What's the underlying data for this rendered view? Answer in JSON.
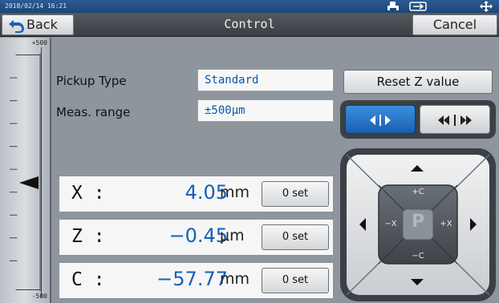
{
  "status": {
    "clock": "2018/02/14 16:21",
    "printer_icon": "printer-icon",
    "usb_icon": "usb-icon",
    "move_icon": "move-arrows-icon"
  },
  "nav": {
    "back_label": "Back",
    "title": "Control",
    "cancel_label": "Cancel"
  },
  "gauge": {
    "max_label": "+500",
    "min_label": "-500"
  },
  "info": {
    "pickup_label": "Pickup Type",
    "pickup_value": "Standard",
    "range_label": "Meas. range",
    "range_value": "±500μm"
  },
  "reset_label": "Reset Z value",
  "step_toggle": {
    "selected": "fine",
    "fine_icon": "fine-step-icon",
    "coarse_icon": "coarse-step-icon"
  },
  "measurements": [
    {
      "axis": "X :",
      "value": "4.05",
      "unit": "mm",
      "set_label": "0 set"
    },
    {
      "axis": "Z :",
      "value": "−0.45",
      "unit": "μm",
      "set_label": "0 set"
    },
    {
      "axis": "C :",
      "value": "−57.77",
      "unit": "mm",
      "set_label": "0 set"
    }
  ],
  "dpad": {
    "plus_c": "+C",
    "minus_c": "−C",
    "minus_x": "−X",
    "plus_x": "+X",
    "center": "P"
  },
  "colors": {
    "accent": "#1a5fae",
    "value_text": "#1560b8"
  }
}
